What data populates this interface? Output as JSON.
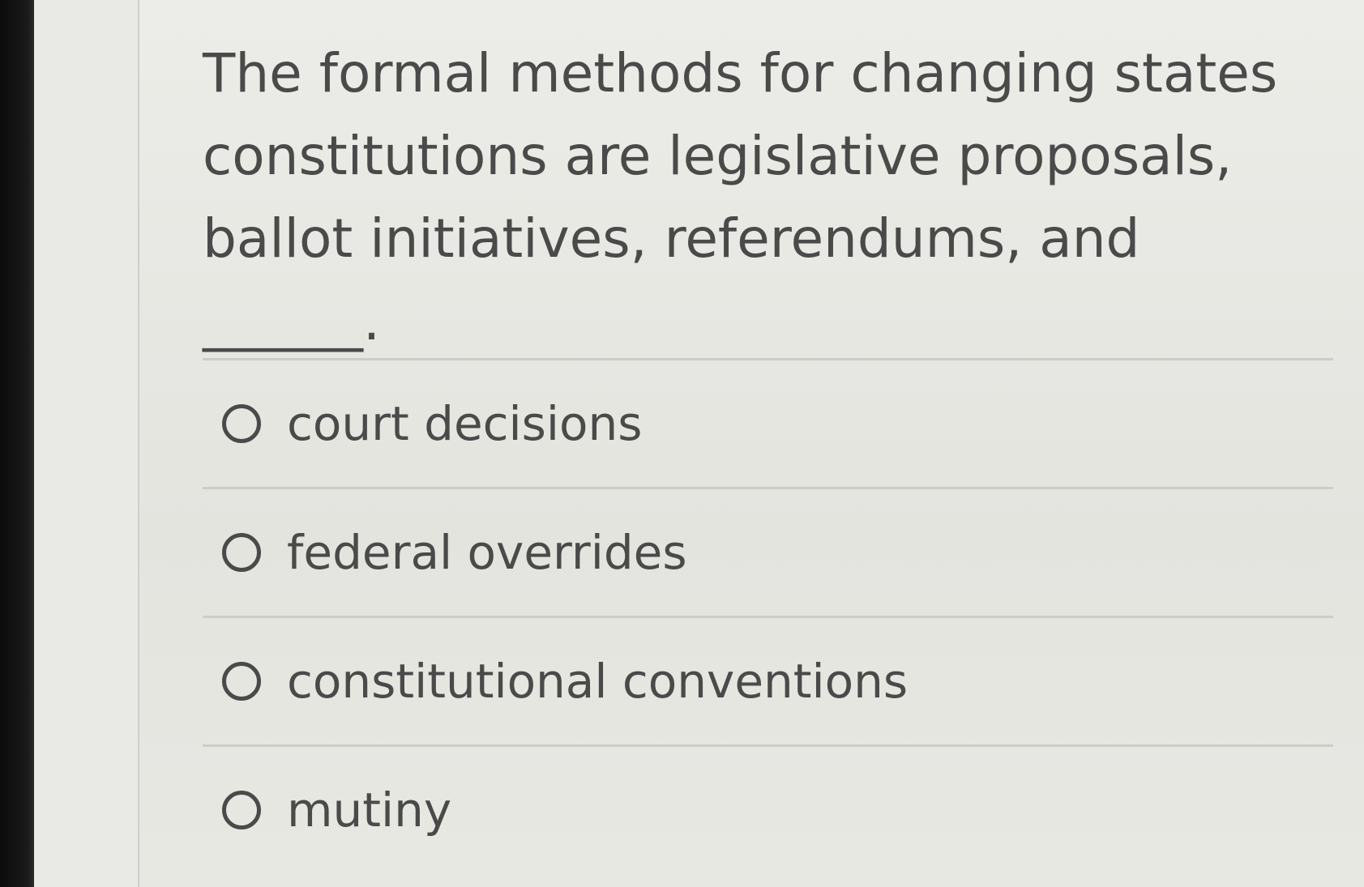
{
  "question": {
    "text": "The formal methods for changing states constitutions are legislative proposals, ballot initiatives, referendums, and ______."
  },
  "options": [
    {
      "label": "court decisions",
      "selected": false
    },
    {
      "label": "federal overrides",
      "selected": false
    },
    {
      "label": "constitutional conventions",
      "selected": false
    },
    {
      "label": "mutiny",
      "selected": false
    }
  ],
  "colors": {
    "text": "#4a4a4a",
    "background": "#e6e6e2",
    "divider": "#cdcdc8"
  }
}
